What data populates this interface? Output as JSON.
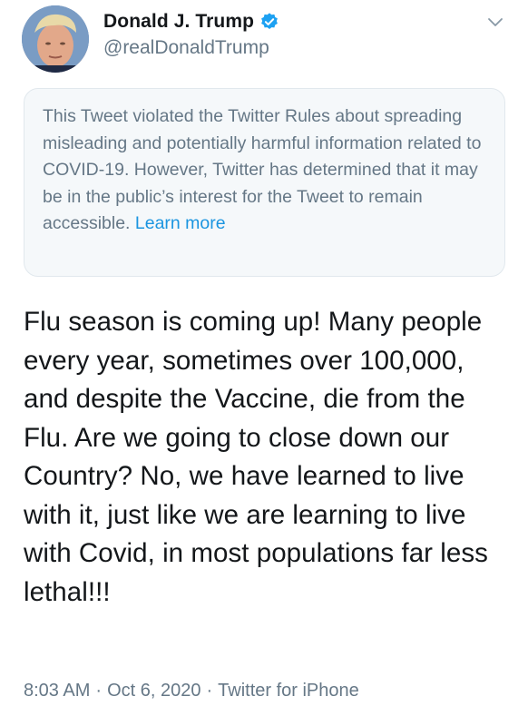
{
  "author": {
    "display_name": "Donald J. Trump",
    "handle": "@realDonaldTrump",
    "verified_icon": "verified-badge-icon",
    "avatar_icon": "profile-avatar"
  },
  "menu_icon": "chevron-down-icon",
  "notice": {
    "text": "This Tweet violated the Twitter Rules about spreading misleading and potentially harmful information related to COVID-19. However, Twitter has determined that it may be in the public’s interest for the Tweet to remain accessible.",
    "link_label": "Learn more"
  },
  "tweet": {
    "text": "Flu season is coming up! Many people every year, sometimes over 100,000, and despite the Vaccine, die from the Flu. Are we going to close down our Country? No, we have learned to live with it, just like we are learning to live with Covid, in most populations far less lethal!!!"
  },
  "meta": {
    "time": "8:03 AM",
    "separator": "·",
    "date": "Oct 6, 2020",
    "source": "Twitter for iPhone"
  },
  "colors": {
    "link": "#1b95e0",
    "muted": "#657786",
    "text": "#14171a",
    "verified": "#1da1f2",
    "notice_bg": "#f5f8fa"
  }
}
